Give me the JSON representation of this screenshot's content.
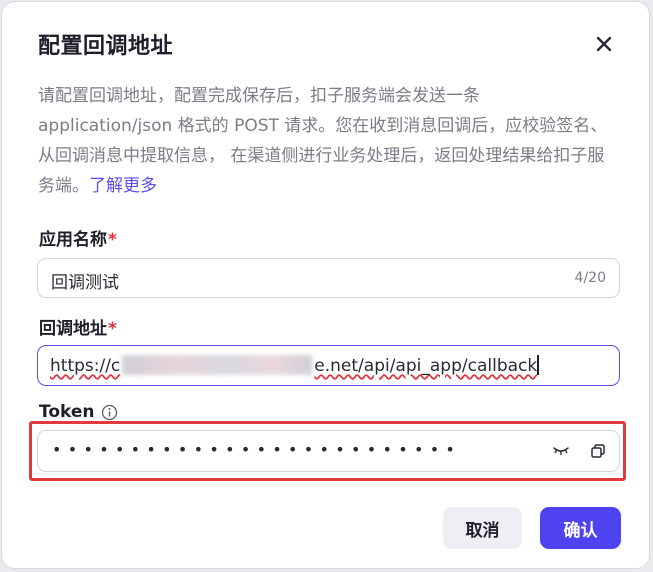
{
  "dialog": {
    "title": "配置回调地址",
    "description": "请配置回调地址，配置完成保存后，扣子服务端会发送一条 application/json 格式的 POST 请求。您在收到消息回调后，应校验签名、从回调消息中提取信息， 在渠道侧进行业务处理后，返回处理结果给扣子服务端。",
    "learn_more": "了解更多"
  },
  "form": {
    "app_name": {
      "label": "应用名称",
      "required_mark": "*",
      "value": "回调测试",
      "counter": "4/20"
    },
    "callback_url": {
      "label": "回调地址",
      "required_mark": "*",
      "value_prefix": "https://c",
      "value_suffix": "e.net/api/api_app/callback"
    },
    "token": {
      "label": "Token",
      "masked_value": "••••••••••••••••••••••••••",
      "icons": [
        "info-icon",
        "eye-closed-icon",
        "copy-icon"
      ]
    }
  },
  "buttons": {
    "cancel": "取消",
    "confirm": "确认"
  },
  "colors": {
    "accent": "#4f43f0",
    "required": "#e0313d",
    "highlight_border": "#e23a3a"
  }
}
